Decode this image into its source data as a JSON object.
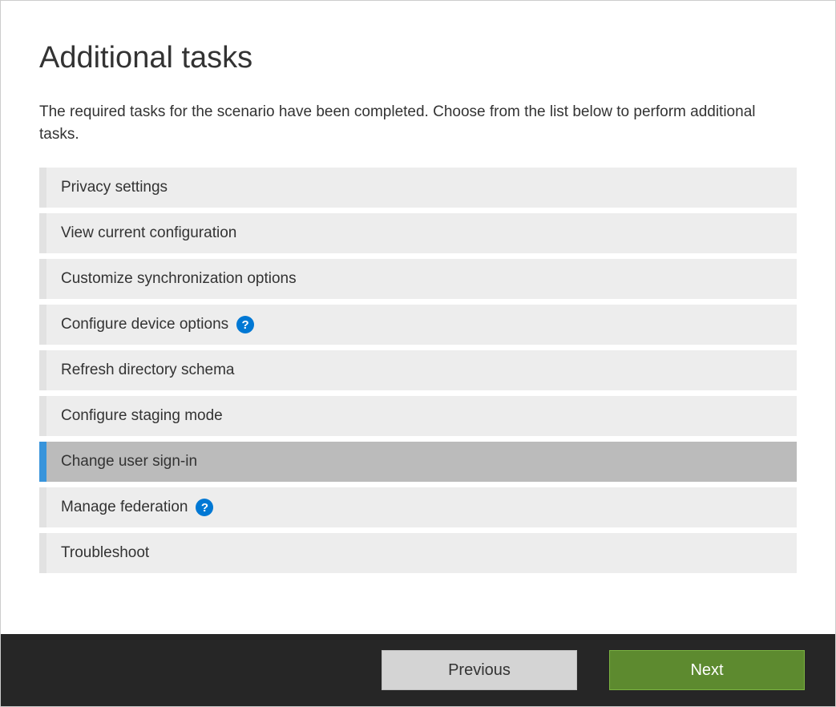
{
  "page": {
    "title": "Additional tasks",
    "description": "The required tasks for the scenario have been completed. Choose from the list below to perform additional tasks."
  },
  "tasks": [
    {
      "label": "Privacy settings",
      "selected": false,
      "help": false
    },
    {
      "label": "View current configuration",
      "selected": false,
      "help": false
    },
    {
      "label": "Customize synchronization options",
      "selected": false,
      "help": false
    },
    {
      "label": "Configure device options",
      "selected": false,
      "help": true
    },
    {
      "label": "Refresh directory schema",
      "selected": false,
      "help": false
    },
    {
      "label": "Configure staging mode",
      "selected": false,
      "help": false
    },
    {
      "label": "Change user sign-in",
      "selected": true,
      "help": false
    },
    {
      "label": "Manage federation",
      "selected": false,
      "help": true
    },
    {
      "label": "Troubleshoot",
      "selected": false,
      "help": false
    }
  ],
  "footer": {
    "previous_label": "Previous",
    "next_label": "Next"
  }
}
